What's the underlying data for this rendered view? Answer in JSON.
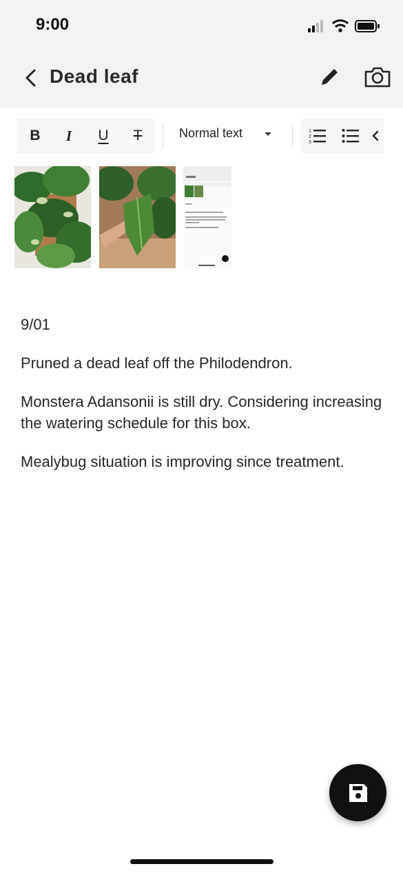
{
  "status_bar": {
    "time": "9:00"
  },
  "header": {
    "title": "Dead leaf",
    "icons": [
      "chevron-left-icon",
      "pencil-icon",
      "camera-icon"
    ]
  },
  "toolbar": {
    "bold_label": "B",
    "italic_label": "I",
    "underline_label": "U",
    "strikethrough_label": "T",
    "text_style": "Normal text"
  },
  "attachments": [
    {
      "name": "plant-photo-1"
    },
    {
      "name": "plant-photo-2"
    },
    {
      "name": "screenshot"
    }
  ],
  "note": {
    "date": "9/01",
    "paragraph_1": "Pruned a dead leaf off the Philodendron.",
    "paragraph_2": "Monstera Adansonii is still dry. Considering increasing the watering schedule for this box.",
    "paragraph_3": "Mealybug situation is improving since treatment."
  },
  "fab": {
    "icon": "save-icon"
  }
}
